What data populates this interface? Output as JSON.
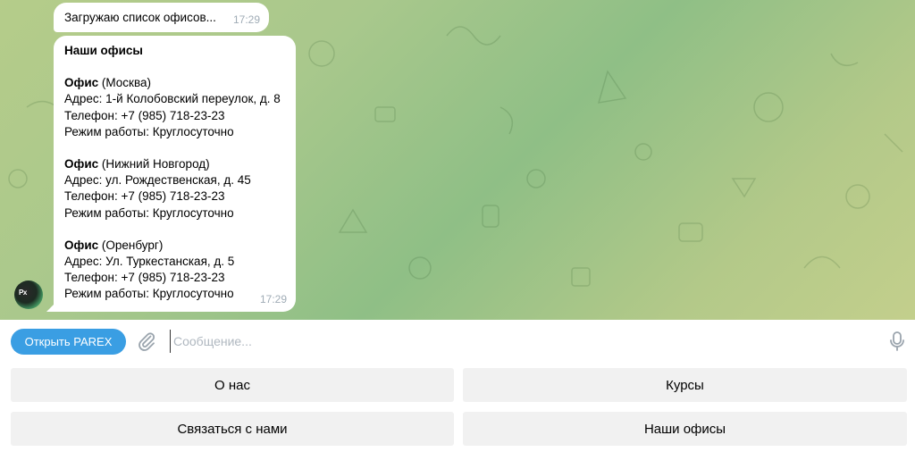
{
  "messages": {
    "loading": {
      "text": "Загружаю список офисов...",
      "time": "17:29"
    },
    "offices": {
      "title": "Наши офисы",
      "time": "17:29",
      "items": [
        {
          "label": "Офис",
          "city": "(Москва)",
          "address": "Адрес: 1-й Колобовский переулок, д. 8",
          "phone": "Телефон: +7 (985) 718-23-23",
          "hours": "Режим работы: Круглосуточно"
        },
        {
          "label": "Офис",
          "city": "(Нижний Новгород)",
          "address": "Адрес: ул. Рождественская, д. 45",
          "phone": "Телефон: +7 (985) 718-23-23",
          "hours": "Режим работы: Круглосуточно"
        },
        {
          "label": "Офис",
          "city": "(Оренбург)",
          "address": "Адрес: Ул. Туркестанская, д. 5",
          "phone": "Телефон: +7 (985) 718-23-23",
          "hours": "Режим работы: Круглосуточно"
        }
      ]
    }
  },
  "input": {
    "open_button": "Открыть PAREX",
    "placeholder": "Сообщение...",
    "attach_icon": "paperclip-icon",
    "mic_icon": "microphone-icon"
  },
  "keyboard": {
    "buttons": [
      "О нас",
      "Курсы",
      "Связаться с нами",
      "Наши офисы"
    ]
  },
  "colors": {
    "accent": "#3a9ee3",
    "bubble": "#ffffff",
    "key_bg": "#f1f1f1"
  }
}
